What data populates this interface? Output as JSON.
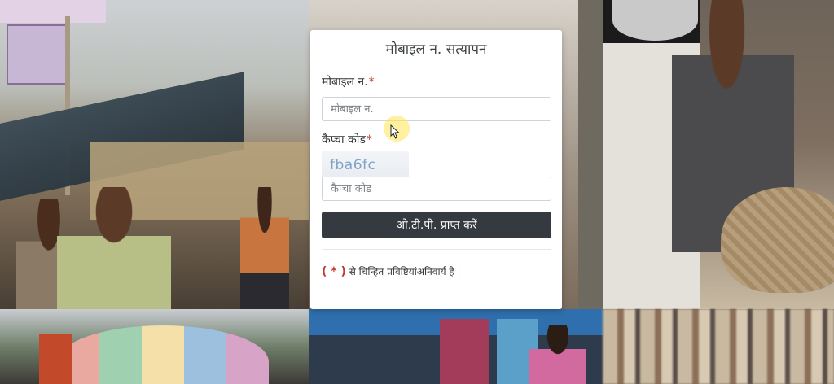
{
  "modal": {
    "title": "मोबाइल न. सत्यापन",
    "mobile": {
      "label": "मोबाइल न.",
      "required_mark": "*",
      "placeholder": "मोबाइल न.",
      "value": ""
    },
    "captcha": {
      "label": "कैप्चा कोड",
      "required_mark": "*",
      "code": "fba6fc",
      "placeholder": "कैप्चा कोड",
      "value": ""
    },
    "submit_label": "ओ.टी.पी. प्राप्त करें",
    "note": {
      "mark": "( * )",
      "text": " से चिन्हित प्रविष्टियांअनिवार्य है |"
    }
  },
  "colors": {
    "button_bg": "#343a40",
    "required": "#c0392b",
    "captcha_text": "#7fa3c7"
  },
  "icons": [
    "mouse-pointer-icon"
  ]
}
